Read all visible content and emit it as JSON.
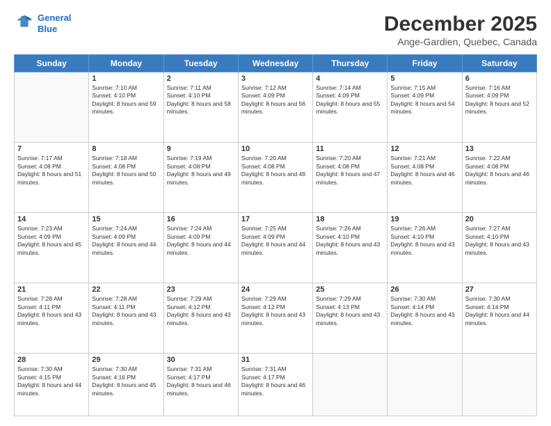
{
  "header": {
    "logo_line1": "General",
    "logo_line2": "Blue",
    "title": "December 2025",
    "subtitle": "Ange-Gardien, Quebec, Canada"
  },
  "weekdays": [
    "Sunday",
    "Monday",
    "Tuesday",
    "Wednesday",
    "Thursday",
    "Friday",
    "Saturday"
  ],
  "rows": [
    [
      {
        "day": "",
        "sunrise": "",
        "sunset": "",
        "daylight": ""
      },
      {
        "day": "1",
        "sunrise": "Sunrise: 7:10 AM",
        "sunset": "Sunset: 4:10 PM",
        "daylight": "Daylight: 8 hours and 59 minutes."
      },
      {
        "day": "2",
        "sunrise": "Sunrise: 7:11 AM",
        "sunset": "Sunset: 4:10 PM",
        "daylight": "Daylight: 8 hours and 58 minutes."
      },
      {
        "day": "3",
        "sunrise": "Sunrise: 7:12 AM",
        "sunset": "Sunset: 4:09 PM",
        "daylight": "Daylight: 8 hours and 56 minutes."
      },
      {
        "day": "4",
        "sunrise": "Sunrise: 7:14 AM",
        "sunset": "Sunset: 4:09 PM",
        "daylight": "Daylight: 8 hours and 55 minutes."
      },
      {
        "day": "5",
        "sunrise": "Sunrise: 7:15 AM",
        "sunset": "Sunset: 4:09 PM",
        "daylight": "Daylight: 8 hours and 54 minutes."
      },
      {
        "day": "6",
        "sunrise": "Sunrise: 7:16 AM",
        "sunset": "Sunset: 4:09 PM",
        "daylight": "Daylight: 8 hours and 52 minutes."
      }
    ],
    [
      {
        "day": "7",
        "sunrise": "Sunrise: 7:17 AM",
        "sunset": "Sunset: 4:08 PM",
        "daylight": "Daylight: 8 hours and 51 minutes."
      },
      {
        "day": "8",
        "sunrise": "Sunrise: 7:18 AM",
        "sunset": "Sunset: 4:08 PM",
        "daylight": "Daylight: 8 hours and 50 minutes."
      },
      {
        "day": "9",
        "sunrise": "Sunrise: 7:19 AM",
        "sunset": "Sunset: 4:08 PM",
        "daylight": "Daylight: 8 hours and 49 minutes."
      },
      {
        "day": "10",
        "sunrise": "Sunrise: 7:20 AM",
        "sunset": "Sunset: 4:08 PM",
        "daylight": "Daylight: 8 hours and 48 minutes."
      },
      {
        "day": "11",
        "sunrise": "Sunrise: 7:20 AM",
        "sunset": "Sunset: 4:08 PM",
        "daylight": "Daylight: 8 hours and 47 minutes."
      },
      {
        "day": "12",
        "sunrise": "Sunrise: 7:21 AM",
        "sunset": "Sunset: 4:08 PM",
        "daylight": "Daylight: 8 hours and 46 minutes."
      },
      {
        "day": "13",
        "sunrise": "Sunrise: 7:22 AM",
        "sunset": "Sunset: 4:08 PM",
        "daylight": "Daylight: 8 hours and 46 minutes."
      }
    ],
    [
      {
        "day": "14",
        "sunrise": "Sunrise: 7:23 AM",
        "sunset": "Sunset: 4:09 PM",
        "daylight": "Daylight: 8 hours and 45 minutes."
      },
      {
        "day": "15",
        "sunrise": "Sunrise: 7:24 AM",
        "sunset": "Sunset: 4:09 PM",
        "daylight": "Daylight: 8 hours and 44 minutes."
      },
      {
        "day": "16",
        "sunrise": "Sunrise: 7:24 AM",
        "sunset": "Sunset: 4:09 PM",
        "daylight": "Daylight: 8 hours and 44 minutes."
      },
      {
        "day": "17",
        "sunrise": "Sunrise: 7:25 AM",
        "sunset": "Sunset: 4:09 PM",
        "daylight": "Daylight: 8 hours and 44 minutes."
      },
      {
        "day": "18",
        "sunrise": "Sunrise: 7:26 AM",
        "sunset": "Sunset: 4:10 PM",
        "daylight": "Daylight: 8 hours and 43 minutes."
      },
      {
        "day": "19",
        "sunrise": "Sunrise: 7:26 AM",
        "sunset": "Sunset: 4:10 PM",
        "daylight": "Daylight: 8 hours and 43 minutes."
      },
      {
        "day": "20",
        "sunrise": "Sunrise: 7:27 AM",
        "sunset": "Sunset: 4:10 PM",
        "daylight": "Daylight: 8 hours and 43 minutes."
      }
    ],
    [
      {
        "day": "21",
        "sunrise": "Sunrise: 7:28 AM",
        "sunset": "Sunset: 4:11 PM",
        "daylight": "Daylight: 8 hours and 43 minutes."
      },
      {
        "day": "22",
        "sunrise": "Sunrise: 7:28 AM",
        "sunset": "Sunset: 4:11 PM",
        "daylight": "Daylight: 8 hours and 43 minutes."
      },
      {
        "day": "23",
        "sunrise": "Sunrise: 7:29 AM",
        "sunset": "Sunset: 4:12 PM",
        "daylight": "Daylight: 8 hours and 43 minutes."
      },
      {
        "day": "24",
        "sunrise": "Sunrise: 7:29 AM",
        "sunset": "Sunset: 4:12 PM",
        "daylight": "Daylight: 8 hours and 43 minutes."
      },
      {
        "day": "25",
        "sunrise": "Sunrise: 7:29 AM",
        "sunset": "Sunset: 4:13 PM",
        "daylight": "Daylight: 8 hours and 43 minutes."
      },
      {
        "day": "26",
        "sunrise": "Sunrise: 7:30 AM",
        "sunset": "Sunset: 4:14 PM",
        "daylight": "Daylight: 8 hours and 43 minutes."
      },
      {
        "day": "27",
        "sunrise": "Sunrise: 7:30 AM",
        "sunset": "Sunset: 4:14 PM",
        "daylight": "Daylight: 8 hours and 44 minutes."
      }
    ],
    [
      {
        "day": "28",
        "sunrise": "Sunrise: 7:30 AM",
        "sunset": "Sunset: 4:15 PM",
        "daylight": "Daylight: 8 hours and 44 minutes."
      },
      {
        "day": "29",
        "sunrise": "Sunrise: 7:30 AM",
        "sunset": "Sunset: 4:16 PM",
        "daylight": "Daylight: 8 hours and 45 minutes."
      },
      {
        "day": "30",
        "sunrise": "Sunrise: 7:31 AM",
        "sunset": "Sunset: 4:17 PM",
        "daylight": "Daylight: 8 hours and 46 minutes."
      },
      {
        "day": "31",
        "sunrise": "Sunrise: 7:31 AM",
        "sunset": "Sunset: 4:17 PM",
        "daylight": "Daylight: 8 hours and 46 minutes."
      },
      {
        "day": "",
        "sunrise": "",
        "sunset": "",
        "daylight": ""
      },
      {
        "day": "",
        "sunrise": "",
        "sunset": "",
        "daylight": ""
      },
      {
        "day": "",
        "sunrise": "",
        "sunset": "",
        "daylight": ""
      }
    ]
  ]
}
